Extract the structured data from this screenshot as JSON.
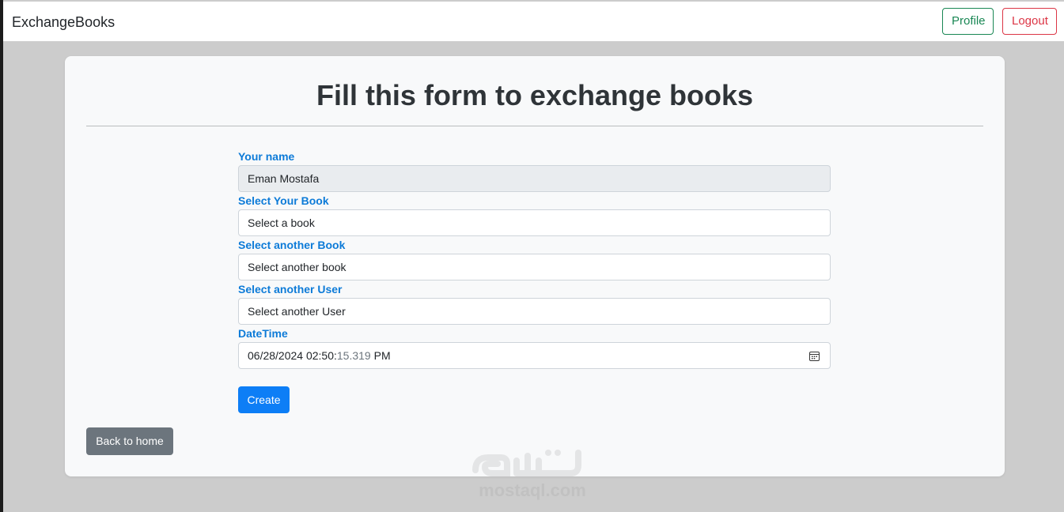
{
  "navbar": {
    "brand": "ExchangeBooks",
    "profile_label": "Profile",
    "logout_label": "Logout"
  },
  "form": {
    "title": "Fill this form to exchange books",
    "name": {
      "label": "Your name",
      "value": "Eman Mostafa"
    },
    "your_book": {
      "label": "Select Your Book",
      "value": "Select a book"
    },
    "another_book": {
      "label": "Select another Book",
      "value": "Select another book"
    },
    "another_user": {
      "label": "Select another User",
      "value": "Select another User"
    },
    "datetime": {
      "label": "DateTime",
      "value_main": "06/28/2024 02:50:",
      "value_muted": "15.319",
      "value_suffix": "PM"
    },
    "create_label": "Create",
    "back_label": "Back to home"
  },
  "watermark": {
    "text": "mostaql.com"
  },
  "colors": {
    "label": "#0d7bd8",
    "primary": "#0d7ef6",
    "secondary": "#6c757d",
    "success": "#198754",
    "danger": "#dc3545"
  }
}
